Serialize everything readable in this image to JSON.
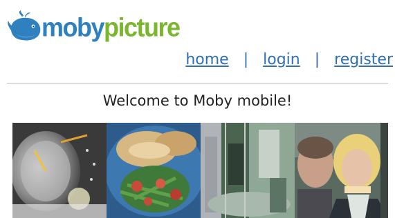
{
  "logo": {
    "word_part1": "moby",
    "word_part2": "picture",
    "icon": "whale-icon",
    "colors": {
      "moby": "#2f80bf",
      "picture": "#7ab62e"
    }
  },
  "nav": {
    "items": [
      {
        "label": "home"
      },
      {
        "label": "login"
      },
      {
        "label": "register"
      }
    ],
    "separator": "|",
    "link_color": "#2f6fb5"
  },
  "welcome": {
    "text": "Welcome to Moby mobile!"
  },
  "gallery": {
    "photos": [
      {
        "icon": "speedometer-photo"
      },
      {
        "icon": "food-plate-photo"
      },
      {
        "icon": "interior-photo"
      },
      {
        "icon": "people-portrait-photo"
      }
    ]
  }
}
